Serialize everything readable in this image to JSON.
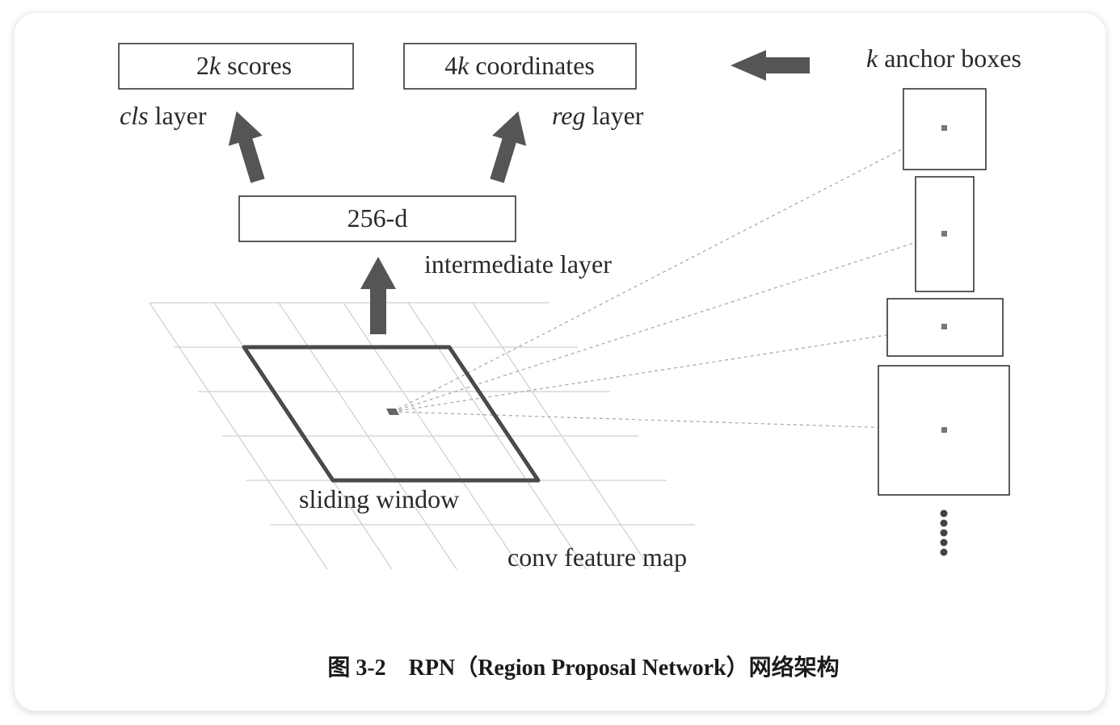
{
  "diagram": {
    "scores_box": {
      "prefix": "2",
      "k": "k",
      "suffix": " scores"
    },
    "coordinates_box": {
      "prefix": "4",
      "k": "k",
      "suffix": " coordinates"
    },
    "cls_layer": {
      "italic": "cls",
      "rest": " layer"
    },
    "reg_layer": {
      "italic": "reg",
      "rest": " layer"
    },
    "anchor_boxes": {
      "k": "k",
      "rest": " anchor boxes"
    },
    "feature_box_label": "256-d",
    "intermediate_layer_label": "intermediate layer",
    "sliding_window_label": "sliding window",
    "conv_feature_map_label": "conv feature map",
    "caption": "图 3-2　RPN（Region Proposal Network）网络架构",
    "colors": {
      "arrow": "#555555",
      "window_border": "#4a4a4a",
      "grid": "#c8c8c8",
      "box_border": "#333333",
      "dashed_line": "#999999"
    }
  }
}
